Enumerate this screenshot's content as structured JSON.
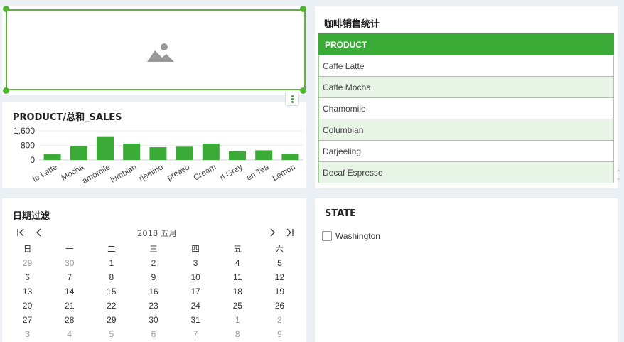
{
  "table_panel": {
    "title": "咖啡销售统计",
    "header": "PRODUCT",
    "rows": [
      "Caffe Latte",
      "Caffe Mocha",
      "Chamomile",
      "Columbian",
      "Darjeeling",
      "Decaf Espresso"
    ]
  },
  "chart_panel": {
    "title": "PRODUCT/总和_SALES"
  },
  "chart_data": {
    "type": "bar",
    "title": "PRODUCT/总和_SALES",
    "categories": [
      "Caffe Latte",
      "Caffe Mocha",
      "Chamomile",
      "Columbian",
      "Darjeeling",
      "Decaf Espresso",
      "Decaf Irish Cream",
      "Earl Grey",
      "Green Tea",
      "Lemon"
    ],
    "tick_labels_visible": [
      "fe Latte",
      "Mocha",
      "amomile",
      "lumbian",
      "rjeeling",
      "presso",
      "Cream",
      "rl Grey",
      "en Tea",
      "Lemon"
    ],
    "values": [
      340,
      760,
      1300,
      900,
      700,
      730,
      900,
      480,
      530,
      350
    ],
    "yticks": [
      "1,600",
      "800",
      "0"
    ],
    "ylim": [
      0,
      1600
    ],
    "bar_color": "#3aab36",
    "grid": true
  },
  "calendar_panel": {
    "title": "日期过滤",
    "month_label": "2018 五月",
    "nav": {
      "first": "|<",
      "prev": "<",
      "next": ">",
      "last": ">|"
    },
    "weekdays": [
      "日",
      "一",
      "二",
      "三",
      "四",
      "五",
      "六"
    ],
    "weeks": [
      [
        {
          "d": "29",
          "m": true
        },
        {
          "d": "30",
          "m": true
        },
        {
          "d": "1"
        },
        {
          "d": "2"
        },
        {
          "d": "3"
        },
        {
          "d": "4"
        },
        {
          "d": "5"
        }
      ],
      [
        {
          "d": "6"
        },
        {
          "d": "7"
        },
        {
          "d": "8"
        },
        {
          "d": "9"
        },
        {
          "d": "10"
        },
        {
          "d": "11"
        },
        {
          "d": "12"
        }
      ],
      [
        {
          "d": "13"
        },
        {
          "d": "14"
        },
        {
          "d": "15"
        },
        {
          "d": "16"
        },
        {
          "d": "17"
        },
        {
          "d": "18"
        },
        {
          "d": "19"
        }
      ],
      [
        {
          "d": "20"
        },
        {
          "d": "21"
        },
        {
          "d": "22"
        },
        {
          "d": "23"
        },
        {
          "d": "24"
        },
        {
          "d": "25"
        },
        {
          "d": "26"
        }
      ],
      [
        {
          "d": "27"
        },
        {
          "d": "28"
        },
        {
          "d": "29"
        },
        {
          "d": "30"
        },
        {
          "d": "31"
        },
        {
          "d": "1",
          "m": true
        },
        {
          "d": "2",
          "m": true
        }
      ],
      [
        {
          "d": "3",
          "m": true
        },
        {
          "d": "4",
          "m": true
        },
        {
          "d": "5",
          "m": true
        },
        {
          "d": "6",
          "m": true
        },
        {
          "d": "7",
          "m": true
        },
        {
          "d": "8",
          "m": true
        },
        {
          "d": "9",
          "m": true
        }
      ]
    ]
  },
  "state_panel": {
    "title": "STATE",
    "option": "Washington"
  },
  "colors": {
    "accent": "#3aab36",
    "selection": "#5cb83a",
    "row_alt": "#e8f5e6"
  },
  "icons": {
    "image_placeholder": "image-placeholder-icon",
    "more": "more-vertical-icon"
  }
}
